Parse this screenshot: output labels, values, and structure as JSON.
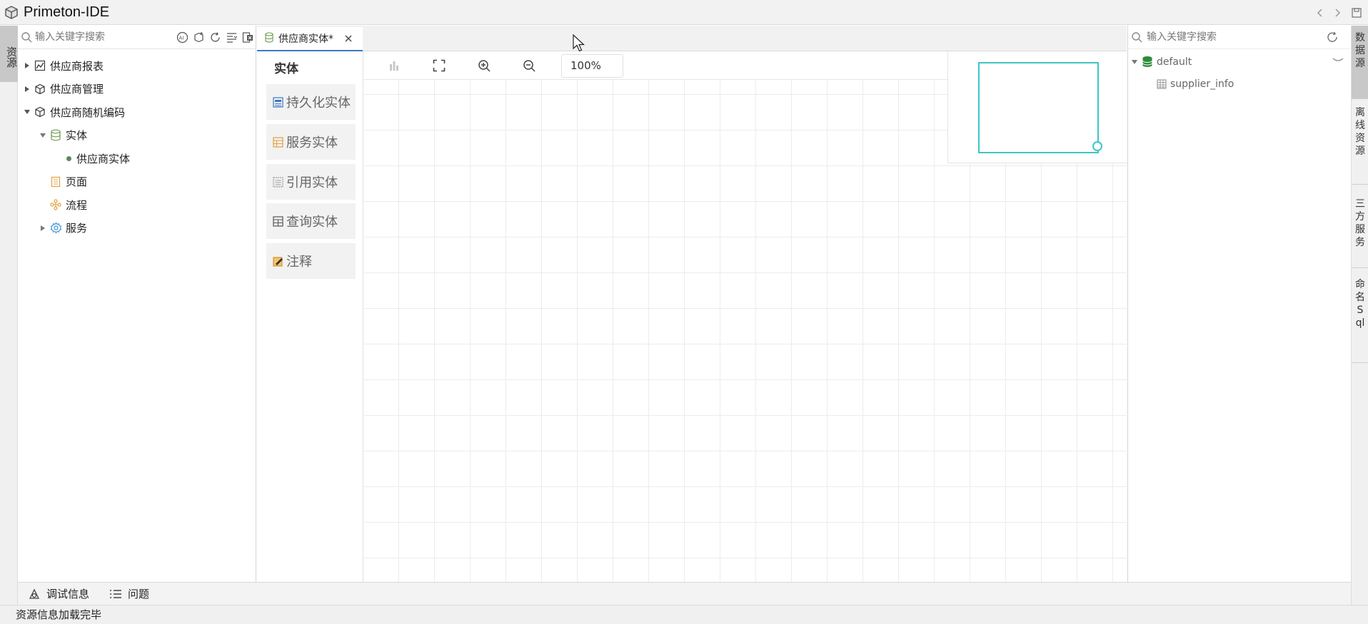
{
  "app": {
    "title": "Primeton-IDE"
  },
  "left_vertical_tab": {
    "label": "资源"
  },
  "left_panel": {
    "search_placeholder": "输入关键字搜索",
    "tree": [
      {
        "label": "供应商报表",
        "icon": "chart-icon",
        "expanded": false
      },
      {
        "label": "供应商管理",
        "icon": "package-icon",
        "expanded": false
      },
      {
        "label": "供应商随机编码",
        "icon": "package-icon",
        "expanded": true
      },
      {
        "label": "实体",
        "icon": "database-icon",
        "expanded": true
      },
      {
        "label": "供应商实体",
        "icon": "dot-icon"
      },
      {
        "label": "页面",
        "icon": "page-icon"
      },
      {
        "label": "流程",
        "icon": "flow-icon"
      },
      {
        "label": "服务",
        "icon": "gear-icon",
        "expanded": false
      }
    ]
  },
  "editor": {
    "tab_label": "供应商实体*",
    "palette_title": "实体",
    "palette_items": [
      "持久化实体",
      "服务实体",
      "引用实体",
      "查询实体",
      "注释"
    ],
    "zoom": "100%"
  },
  "right_panel": {
    "search_placeholder": "输入关键字搜索",
    "datasource": "default",
    "table": "supplier_info"
  },
  "right_vertical_tabs": [
    "数据源",
    "离线资源",
    "三方服务",
    "命名Sql"
  ],
  "bottom": {
    "debug_label": "调试信息",
    "problems_label": "问题"
  },
  "status": {
    "text": "资源信息加载完毕"
  },
  "colors": {
    "accent": "#3b78c4",
    "minimap": "#3ec6c6",
    "datasource": "#2e8b3a"
  }
}
